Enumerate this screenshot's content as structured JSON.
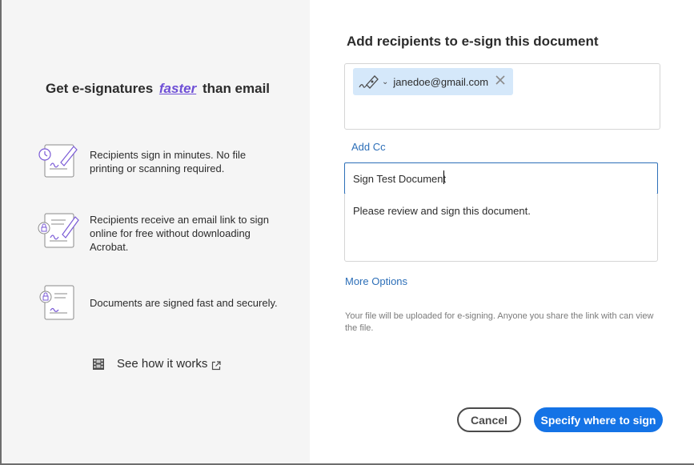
{
  "promo": {
    "title_before": "Get e-signatures",
    "title_emphasis": "faster",
    "title_after": "than email",
    "features": [
      {
        "icon": "signing-form-icon",
        "text": "Recipients sign in minutes. No file printing or scanning required."
      },
      {
        "icon": "email-sign-link-icon",
        "text": "Recipients receive an email link to sign online for free without downloading Acrobat."
      },
      {
        "icon": "secure-document-icon",
        "text": "Documents are signed fast and securely."
      }
    ],
    "see_how_label": "See how it works"
  },
  "dialog": {
    "title": "Add recipients to e-sign this document",
    "recipient": {
      "email": "janedoe@gmail.com",
      "role_icon": "signer-pen-icon"
    },
    "add_cc_label": "Add Cc",
    "subject_value": "Sign Test Document",
    "message_value": "Please review and sign this document.",
    "more_options_label": "More Options",
    "upload_note": "Your file will be uploaded for e-signing. Anyone you share the link with can view the file.",
    "cancel_label": "Cancel",
    "primary_label": "Specify where to sign"
  },
  "colors": {
    "accent": "#1473e6",
    "link": "#2d6fb8",
    "emphasis": "#6e4fd6",
    "chip_bg": "#d5e8fa",
    "left_panel_bg": "#f5f5f5"
  }
}
